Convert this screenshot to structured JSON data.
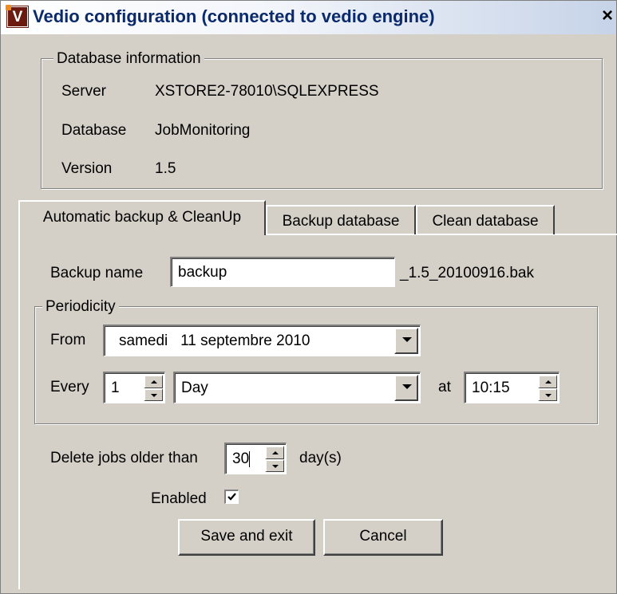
{
  "window": {
    "title": "Vedio configuration (connected to vedio engine)",
    "icon_letter": "V",
    "close_glyph": "×"
  },
  "database_info": {
    "legend": "Database information",
    "rows": [
      {
        "label": "Server",
        "value": "XSTORE2-78010\\SQLEXPRESS"
      },
      {
        "label": "Database",
        "value": "JobMonitoring"
      },
      {
        "label": "Version",
        "value": "1.5"
      }
    ]
  },
  "tabs": [
    {
      "label": "Automatic backup & CleanUp",
      "active": true
    },
    {
      "label": "Backup database",
      "active": false
    },
    {
      "label": "Clean database",
      "active": false
    }
  ],
  "backup": {
    "name_label": "Backup name",
    "name_value": "backup",
    "name_suffix": "_1.5_20100916.bak"
  },
  "periodicity": {
    "legend": "Periodicity",
    "from_label": "From",
    "from_value": "samedi   11 septembre 2010",
    "every_label": "Every",
    "every_value": "1",
    "unit_value": "Day",
    "at_label": "at",
    "time_value": "10:15"
  },
  "cleanup": {
    "delete_label": "Delete jobs older than",
    "days_value": "30",
    "days_unit": "day(s)",
    "enabled_label": "Enabled",
    "enabled": true
  },
  "buttons": {
    "save_label": "Save and exit",
    "cancel_label": "Cancel"
  },
  "colors": {
    "face": "#d4d0c8",
    "title_text": "#0b2a6b",
    "icon_bg": "#6b1a10"
  }
}
